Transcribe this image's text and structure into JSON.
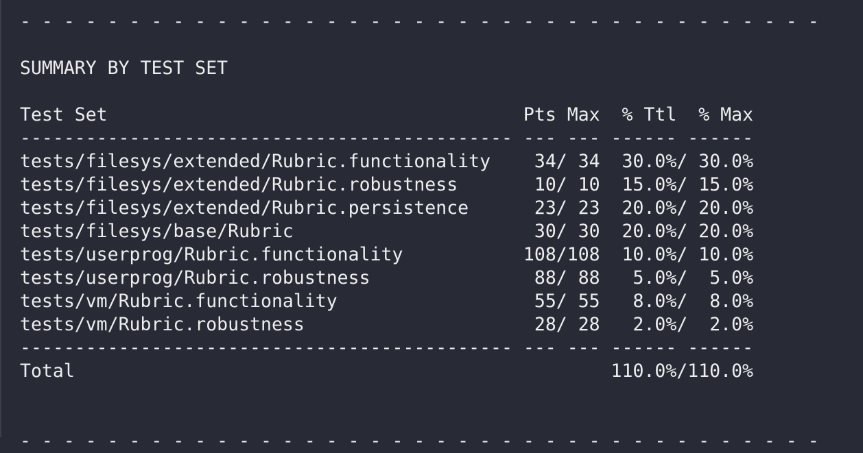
{
  "top_rule": "- - - - - - - - - - - - - - - - - - - - - - - - - - - - - - - - - - - - -",
  "bottom_rule": "- - - - - - - - - - - - - - - - - - - - - - - - - - - - - - - - - - - - -",
  "title": "SUMMARY BY TEST SET",
  "header": {
    "test_set": "Test Set",
    "pts": "Pts",
    "max": "Max",
    "pct_ttl": "% Ttl",
    "pct_max": "% Max"
  },
  "separator": "--------------------------------------------- --- --- ------ ------",
  "rows": [
    {
      "name": "tests/filesys/extended/Rubric.functionality",
      "pts": "34",
      "max": "34",
      "ttl": "30.0%",
      "pmax": "30.0%"
    },
    {
      "name": "tests/filesys/extended/Rubric.robustness",
      "pts": "10",
      "max": "10",
      "ttl": "15.0%",
      "pmax": "15.0%"
    },
    {
      "name": "tests/filesys/extended/Rubric.persistence",
      "pts": "23",
      "max": "23",
      "ttl": "20.0%",
      "pmax": "20.0%"
    },
    {
      "name": "tests/filesys/base/Rubric",
      "pts": "30",
      "max": "30",
      "ttl": "20.0%",
      "pmax": "20.0%"
    },
    {
      "name": "tests/userprog/Rubric.functionality",
      "pts": "108",
      "max": "108",
      "ttl": "10.0%",
      "pmax": "10.0%"
    },
    {
      "name": "tests/userprog/Rubric.robustness",
      "pts": "88",
      "max": "88",
      "ttl": "5.0%",
      "pmax": "5.0%"
    },
    {
      "name": "tests/vm/Rubric.functionality",
      "pts": "55",
      "max": "55",
      "ttl": "8.0%",
      "pmax": "8.0%"
    },
    {
      "name": "tests/vm/Rubric.robustness",
      "pts": "28",
      "max": "28",
      "ttl": "2.0%",
      "pmax": "2.0%"
    }
  ],
  "total": {
    "label": "Total",
    "ttl": "110.0%",
    "pmax": "110.0%"
  },
  "colors": {
    "background": "#282a35",
    "text": "#eeeeee"
  }
}
